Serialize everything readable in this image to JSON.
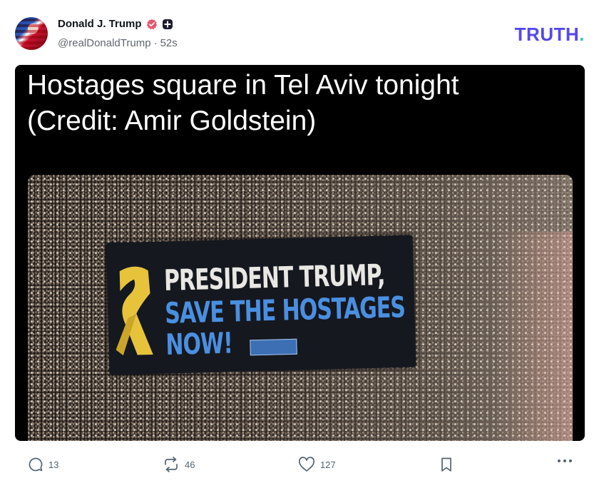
{
  "post": {
    "author": {
      "display_name": "Donald J. Trump",
      "handle": "@realDonaldTrump",
      "separator": "·",
      "time": "52s",
      "verified_icon": "verified-badge-icon",
      "badge_icon": "plus-badge-icon"
    },
    "media_caption_line1": "Hostages square in Tel Aviv tonight",
    "media_caption_line2": "(Credit: Amir Goldstein)",
    "banner": {
      "line1": "PRESIDENT TRUMP,",
      "line2": "SAVE THE HOSTAGES",
      "line3": "NOW!"
    }
  },
  "brand": {
    "logo_text": "TRUTH",
    "logo_dot": ".",
    "accent": "#5448ee",
    "dot_color": "#3cc3b3"
  },
  "actions": {
    "reply_count": "13",
    "retruth_count": "46",
    "like_count": "127"
  }
}
